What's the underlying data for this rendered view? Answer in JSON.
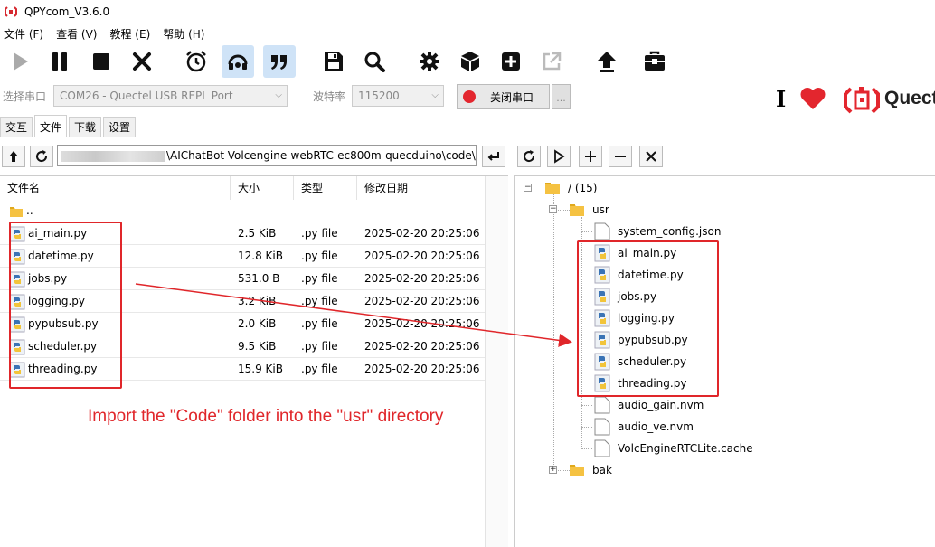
{
  "window": {
    "title": "QPYcom_V3.6.0"
  },
  "menu": [
    "文件 (F)",
    "查看 (V)",
    "教程 (E)",
    "帮助 (H)"
  ],
  "toolbar": {
    "buttons": [
      "play-icon",
      "pause-icon",
      "stop-icon",
      "close-icon",
      "alarm-icon",
      "headset-icon",
      "quote-icon",
      "save-icon",
      "search-icon",
      "gear-icon",
      "cube-icon",
      "plus-box-icon",
      "external-link-icon",
      "upload-icon",
      "toolbox-icon"
    ]
  },
  "serial": {
    "port_label": "选择串口",
    "port_value": "COM26 - Quectel USB REPL Port",
    "baud_label": "波特率",
    "baud_value": "115200",
    "open_button": "关闭串口",
    "more_button": "..."
  },
  "brand": {
    "logo_text": "Quectel"
  },
  "tabs": [
    {
      "label": "交互",
      "active": false
    },
    {
      "label": "文件",
      "active": true
    },
    {
      "label": "下载",
      "active": false
    },
    {
      "label": "设置",
      "active": false
    }
  ],
  "local": {
    "path": "\\AIChatBot-Volcengine-webRTC-ec800m-quecduino\\code\\",
    "columns": [
      "文件名",
      "大小",
      "类型",
      "修改日期"
    ],
    "parent_dir": "..",
    "files": [
      {
        "name": "ai_main.py",
        "size": "2.5 KiB",
        "type": ".py file",
        "date": "2025-02-20 20:25:06"
      },
      {
        "name": "datetime.py",
        "size": "12.8 KiB",
        "type": ".py file",
        "date": "2025-02-20 20:25:06"
      },
      {
        "name": "jobs.py",
        "size": "531.0 B",
        "type": ".py file",
        "date": "2025-02-20 20:25:06"
      },
      {
        "name": "logging.py",
        "size": "3.2 KiB",
        "type": ".py file",
        "date": "2025-02-20 20:25:06"
      },
      {
        "name": "pypubsub.py",
        "size": "2.0 KiB",
        "type": ".py file",
        "date": "2025-02-20 20:25:06"
      },
      {
        "name": "scheduler.py",
        "size": "9.5 KiB",
        "type": ".py file",
        "date": "2025-02-20 20:25:06"
      },
      {
        "name": "threading.py",
        "size": "15.9 KiB",
        "type": ".py file",
        "date": "2025-02-20 20:25:06"
      }
    ]
  },
  "annotation": "Import the \"Code\" folder into the \"usr\" directory",
  "device": {
    "root": "/ (15)",
    "usr_folder": "usr",
    "usr_files": [
      "system_config.json",
      "ai_main.py",
      "datetime.py",
      "jobs.py",
      "logging.py",
      "pypubsub.py",
      "scheduler.py",
      "threading.py",
      "audio_gain.nvm",
      "audio_ve.nvm",
      "VolcEngineRTCLite.cache"
    ],
    "bak_folder": "bak"
  },
  "colors": {
    "accent_red": "#e0262a",
    "active_button": "#cfe3f7",
    "folder": "#f5c242"
  }
}
